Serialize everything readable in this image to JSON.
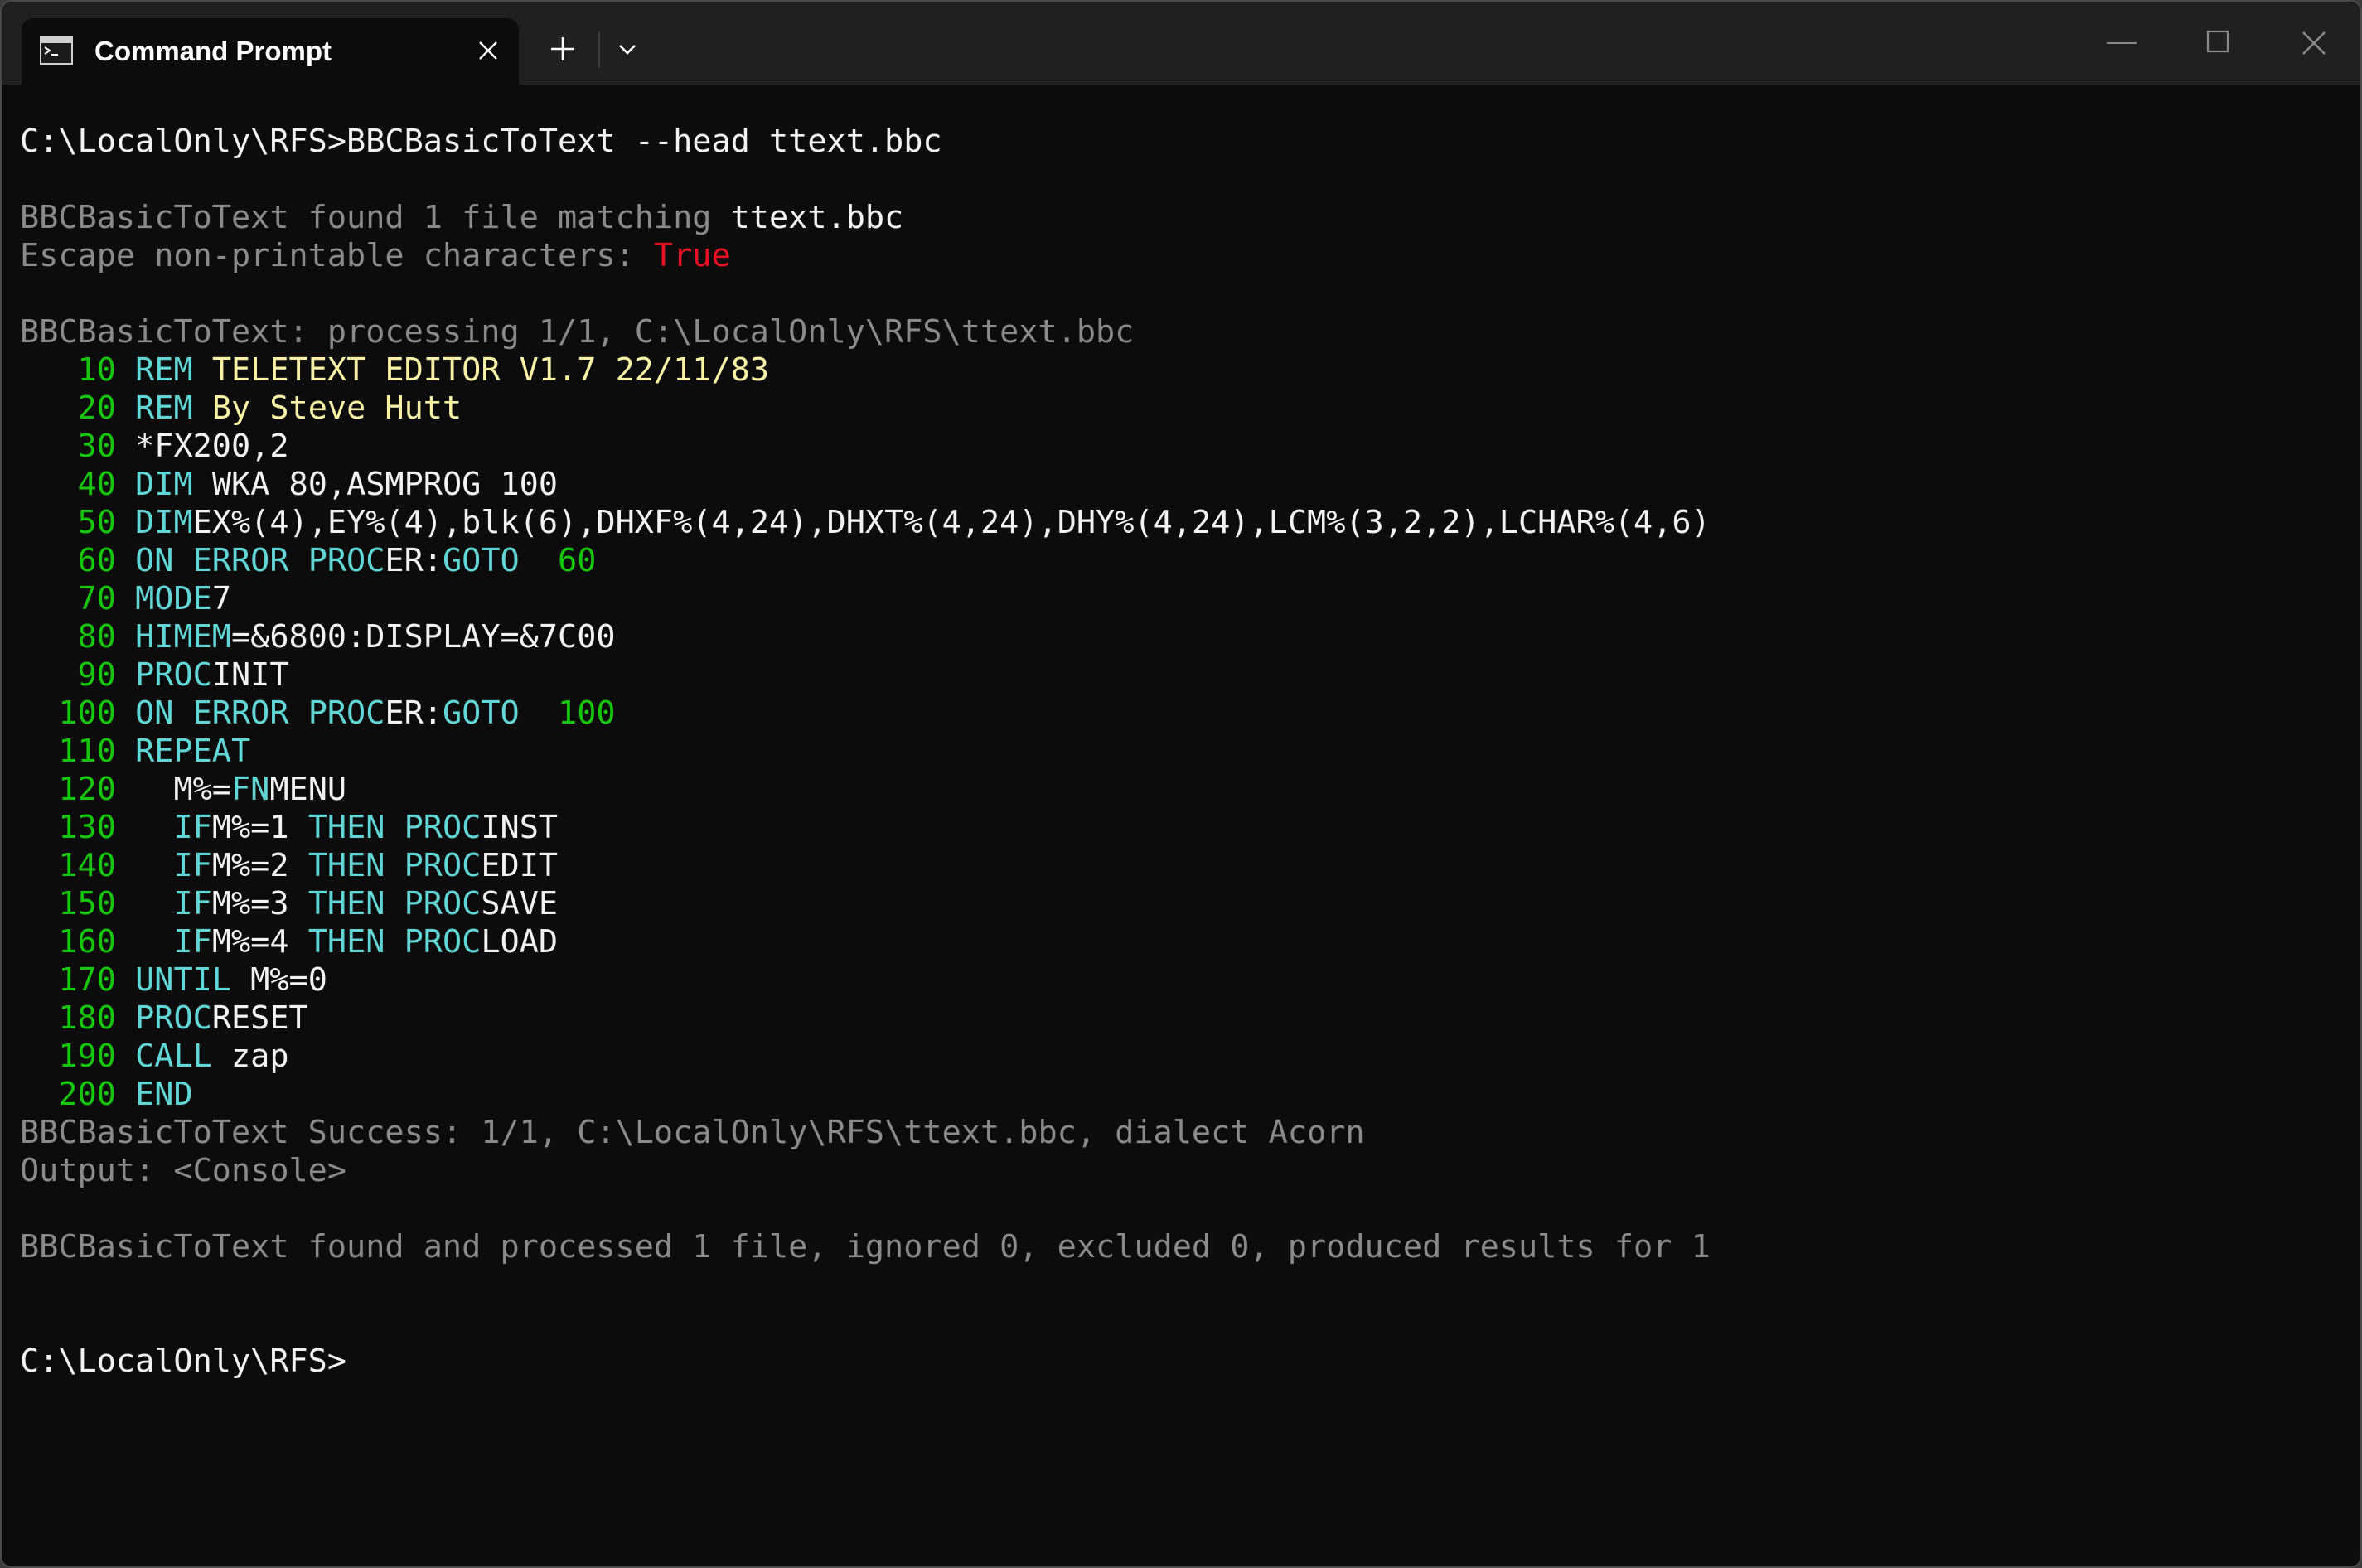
{
  "window": {
    "tab_title": "Command Prompt",
    "icons": {
      "tab": "terminal-icon",
      "close_tab": "close-icon",
      "new_tab": "plus-icon",
      "dropdown": "chevron-down-icon",
      "minimize": "minimize-icon",
      "maximize": "maximize-icon",
      "close_window": "close-icon"
    }
  },
  "colors": {
    "background": "#0c0c0c",
    "titlebar": "#202020",
    "gray_text": "#8a8a8a",
    "keyword": "#3a96dd",
    "line_number": "#16c60c",
    "remark": "#f9f1a5",
    "true_value": "#e81123"
  },
  "console": {
    "command_prompt": "C:\\LocalOnly\\RFS>",
    "command": "BBCBasicToText --head ttext.bbc",
    "found_prefix": "BBCBasicToText found 1 file matching ",
    "found_file": "ttext.bbc",
    "escape_label": "Escape non-printable characters: ",
    "escape_value": "True",
    "processing": "BBCBasicToText: processing 1/1, C:\\LocalOnly\\RFS\\ttext.bbc",
    "code": [
      {
        "num": "   10",
        "parts": [
          {
            "t": "REM",
            "c": "cyanlt"
          },
          {
            "t": " TELETEXT EDITOR V1.7 22/11/83",
            "c": "yellow"
          }
        ]
      },
      {
        "num": "   20",
        "parts": [
          {
            "t": "REM",
            "c": "cyanlt"
          },
          {
            "t": " By Steve Hutt",
            "c": "yellow"
          }
        ]
      },
      {
        "num": "   30",
        "parts": [
          {
            "t": "*FX200,2",
            "c": "white"
          }
        ]
      },
      {
        "num": "   40",
        "parts": [
          {
            "t": "DIM",
            "c": "cyanlt"
          },
          {
            "t": " WKA 80,ASMPROG 100",
            "c": "white"
          }
        ]
      },
      {
        "num": "   50",
        "parts": [
          {
            "t": "DIM",
            "c": "cyanlt"
          },
          {
            "t": "EX%(4),EY%(4),blk(6),DHXF%(4,24),DHXT%(4,24),DHY%(4,24),LCM%(3,2,2),LCHAR%(4,6)",
            "c": "white"
          }
        ]
      },
      {
        "num": "   60",
        "parts": [
          {
            "t": "ON ERROR PROC",
            "c": "cyanlt"
          },
          {
            "t": "ER:",
            "c": "white"
          },
          {
            "t": "GOTO",
            "c": "cyanlt"
          },
          {
            "t": "  60",
            "c": "green"
          }
        ]
      },
      {
        "num": "   70",
        "parts": [
          {
            "t": "MODE",
            "c": "cyanlt"
          },
          {
            "t": "7",
            "c": "white"
          }
        ]
      },
      {
        "num": "   80",
        "parts": [
          {
            "t": "HIMEM",
            "c": "cyanlt"
          },
          {
            "t": "=&6800:DISPLAY=&7C00",
            "c": "white"
          }
        ]
      },
      {
        "num": "   90",
        "parts": [
          {
            "t": "PROC",
            "c": "cyanlt"
          },
          {
            "t": "INIT",
            "c": "white"
          }
        ]
      },
      {
        "num": "  100",
        "parts": [
          {
            "t": "ON ERROR PROC",
            "c": "cyanlt"
          },
          {
            "t": "ER:",
            "c": "white"
          },
          {
            "t": "GOTO",
            "c": "cyanlt"
          },
          {
            "t": "  100",
            "c": "green"
          }
        ]
      },
      {
        "num": "  110",
        "parts": [
          {
            "t": "REPEAT",
            "c": "cyanlt"
          }
        ]
      },
      {
        "num": "  120",
        "parts": [
          {
            "t": "  M%=",
            "c": "white"
          },
          {
            "t": "FN",
            "c": "cyanlt"
          },
          {
            "t": "MENU",
            "c": "white"
          }
        ]
      },
      {
        "num": "  130",
        "parts": [
          {
            "t": "  IF",
            "c": "cyanlt"
          },
          {
            "t": "M%=1 ",
            "c": "white"
          },
          {
            "t": "THEN PROC",
            "c": "cyanlt"
          },
          {
            "t": "INST",
            "c": "white"
          }
        ]
      },
      {
        "num": "  140",
        "parts": [
          {
            "t": "  IF",
            "c": "cyanlt"
          },
          {
            "t": "M%=2 ",
            "c": "white"
          },
          {
            "t": "THEN PROC",
            "c": "cyanlt"
          },
          {
            "t": "EDIT",
            "c": "white"
          }
        ]
      },
      {
        "num": "  150",
        "parts": [
          {
            "t": "  IF",
            "c": "cyanlt"
          },
          {
            "t": "M%=3 ",
            "c": "white"
          },
          {
            "t": "THEN PROC",
            "c": "cyanlt"
          },
          {
            "t": "SAVE",
            "c": "white"
          }
        ]
      },
      {
        "num": "  160",
        "parts": [
          {
            "t": "  IF",
            "c": "cyanlt"
          },
          {
            "t": "M%=4 ",
            "c": "white"
          },
          {
            "t": "THEN PROC",
            "c": "cyanlt"
          },
          {
            "t": "LOAD",
            "c": "white"
          }
        ]
      },
      {
        "num": "  170",
        "parts": [
          {
            "t": "UNTIL",
            "c": "cyanlt"
          },
          {
            "t": " M%=0",
            "c": "white"
          }
        ]
      },
      {
        "num": "  180",
        "parts": [
          {
            "t": "PROC",
            "c": "cyanlt"
          },
          {
            "t": "RESET",
            "c": "white"
          }
        ]
      },
      {
        "num": "  190",
        "parts": [
          {
            "t": "CALL",
            "c": "cyanlt"
          },
          {
            "t": " zap",
            "c": "white"
          }
        ]
      },
      {
        "num": "  200",
        "parts": [
          {
            "t": "END",
            "c": "cyanlt"
          }
        ]
      }
    ],
    "success": "BBCBasicToText Success: 1/1, C:\\LocalOnly\\RFS\\ttext.bbc, dialect Acorn",
    "output": "Output: <Console>",
    "summary": "BBCBasicToText found and processed 1 file, ignored 0, excluded 0, produced results for 1",
    "final_prompt": "C:\\LocalOnly\\RFS>"
  }
}
